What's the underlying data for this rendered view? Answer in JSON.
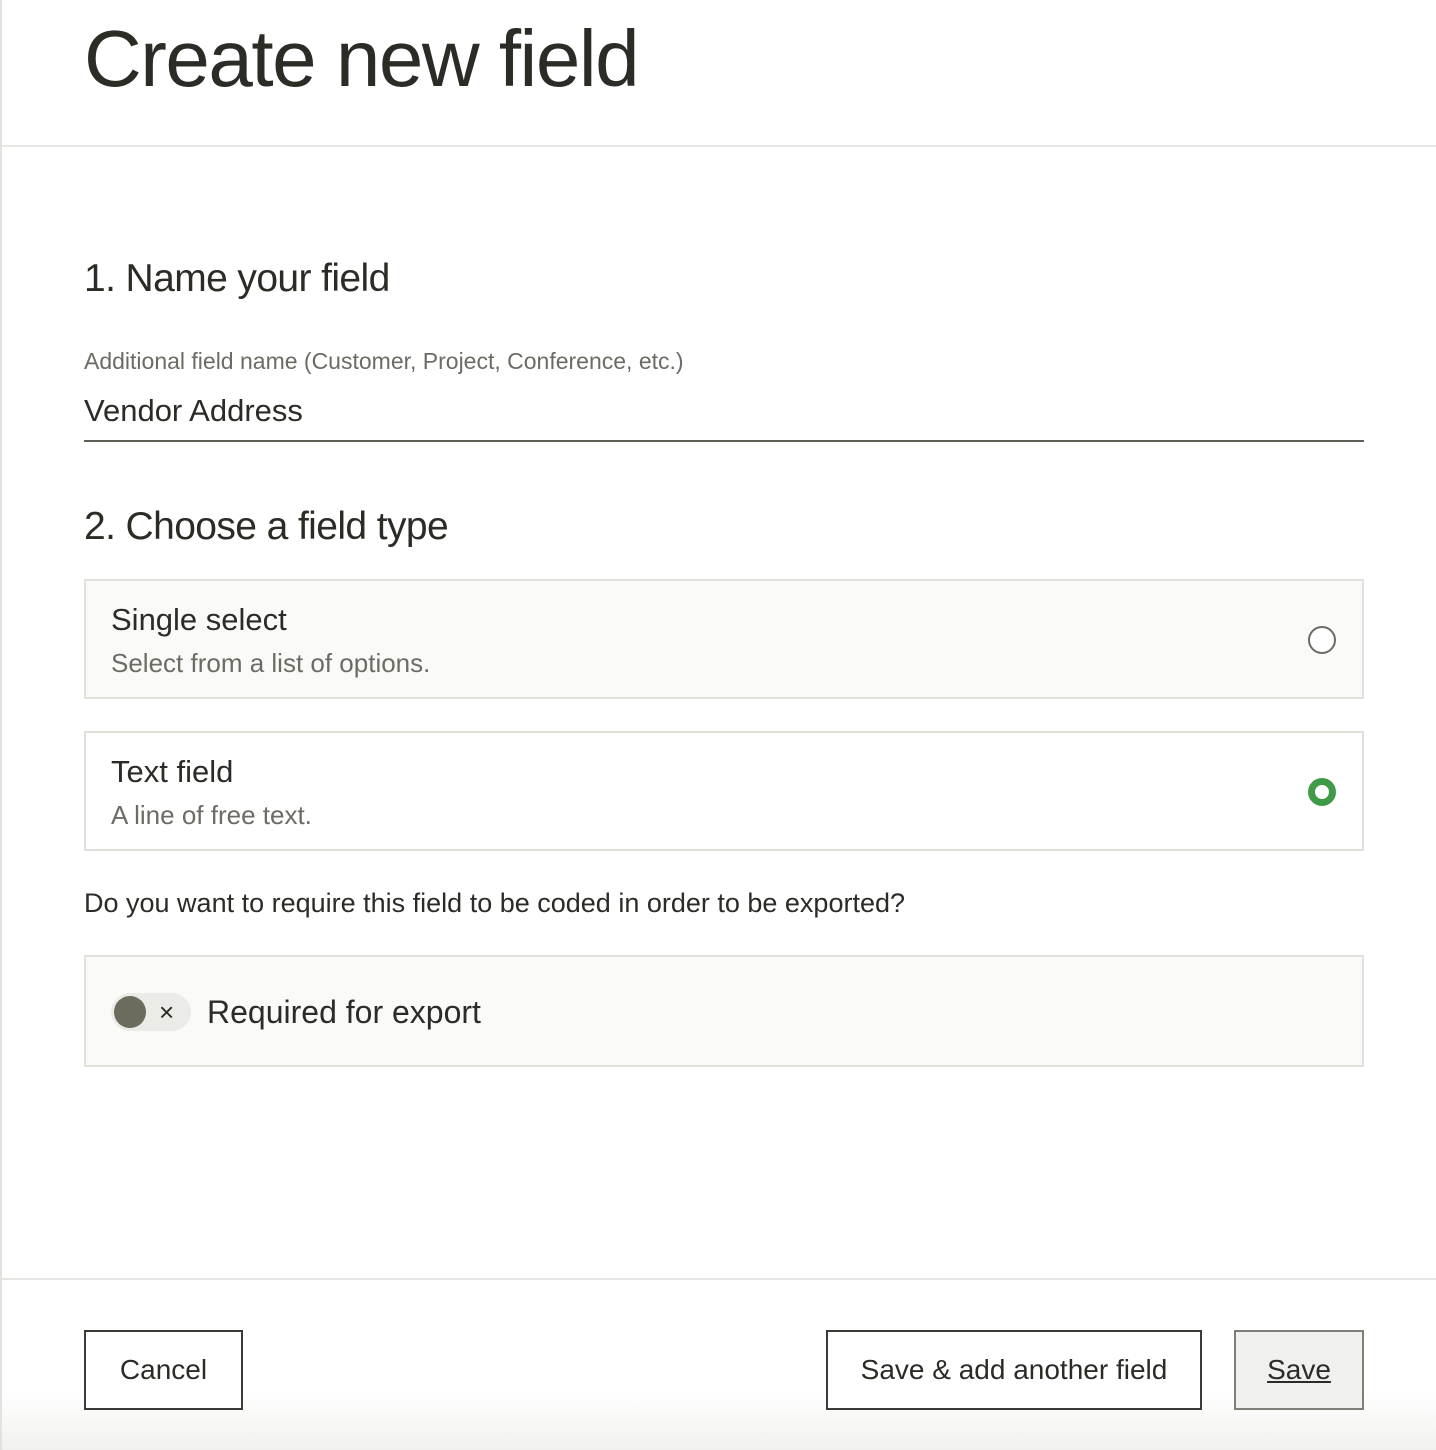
{
  "header": {
    "title": "Create new field"
  },
  "section_name": {
    "heading": "1. Name your field",
    "field_label": "Additional field name (Customer, Project, Conference, etc.)",
    "field_value": "Vendor Address"
  },
  "section_type": {
    "heading": "2. Choose a field type",
    "options": [
      {
        "title": "Single select",
        "description": "Select from a list of options.",
        "selected": false
      },
      {
        "title": "Text field",
        "description": "A line of free text.",
        "selected": true
      }
    ]
  },
  "export": {
    "question": "Do you want to require this field to be coded in order to be exported?",
    "toggle_label": "Required for export",
    "toggle_on": false,
    "toggle_off_glyph": "×"
  },
  "footer": {
    "cancel_label": "Cancel",
    "save_add_label": "Save & add another field",
    "save_label": "Save"
  },
  "colors": {
    "accent_green": "#3f9b47",
    "text_primary": "#2b2c26",
    "text_secondary": "#6b6c63"
  }
}
